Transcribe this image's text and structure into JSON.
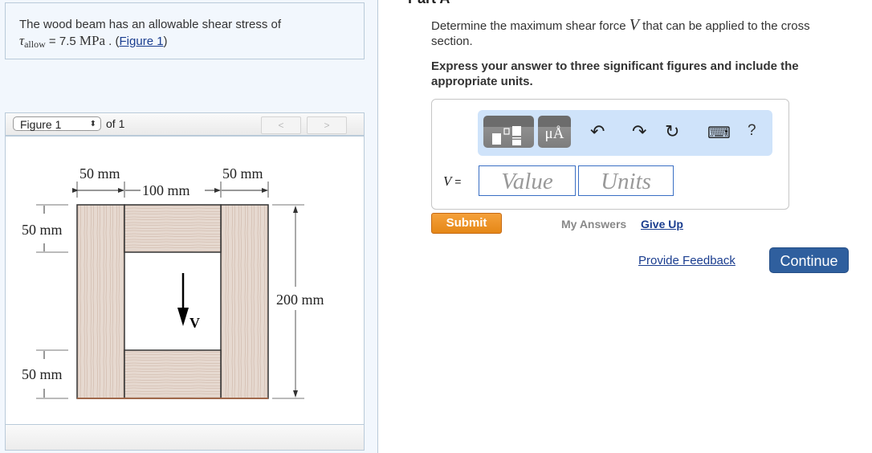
{
  "problem": {
    "text_line1": "The wood beam has an allowable shear stress of",
    "tau_symbol": "τ",
    "tau_subscript": "allow",
    "equals": " = 7.5 ",
    "unit": "MPa",
    "period": " . (",
    "figure_link": "Figure 1",
    "close_paren": ")"
  },
  "figure_nav": {
    "select_value": "Figure 1",
    "select_arrows": "▲▼",
    "of_label": "of 1",
    "prev_label": "<",
    "next_label": ">"
  },
  "figure": {
    "dim_top_left": "50 mm",
    "dim_top_middle": "100 mm",
    "dim_top_right": "50 mm",
    "dim_left_top": "50 mm",
    "dim_left_bottom": "50 mm",
    "dim_right": "200 mm",
    "force_label": "V"
  },
  "part": {
    "title": "Part A",
    "question_before": "Determine the maximum shear force ",
    "question_var": "V",
    "question_after": " that can be applied to the cross section.",
    "instruction": "Express your answer to three significant figures and include the appropriate units."
  },
  "toolbar": {
    "templates_icon": "templates-icon",
    "units_label": "μÅ",
    "undo_icon": "↶",
    "redo_icon": "↷",
    "reset_icon": "↻",
    "keyboard_icon": "⌨",
    "help_label": "?"
  },
  "answer": {
    "var_label": "V",
    "equals": " =",
    "value_placeholder": "Value",
    "units_placeholder": "Units"
  },
  "actions": {
    "submit": "Submit",
    "my_answers": "My Answers",
    "give_up": "Give Up",
    "provide_feedback": "Provide Feedback",
    "continue": "Continue"
  }
}
